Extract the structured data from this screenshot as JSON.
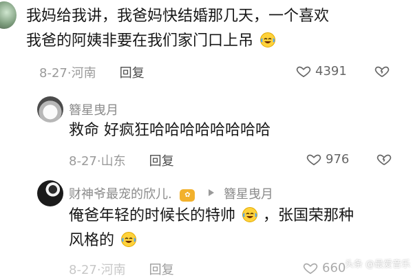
{
  "comments": [
    {
      "text_line1": "我妈给我讲，我爸妈快结婚那几天，一个喜欢",
      "text_line2": "我爸的阿姨非要在我们家门口上吊",
      "date_location": "8-27·河南",
      "reply_label": "回复",
      "likes": "4391"
    }
  ],
  "replies": [
    {
      "username": "簪星曳月",
      "text": "救命 好疯狂哈哈哈哈哈哈哈哈",
      "date_location": "8-27·山东",
      "reply_label": "回复",
      "likes": "976"
    },
    {
      "username": "财神爷最宠的欣儿.",
      "reply_to": "簪星曳月",
      "text_line1": "俺爸年轻的时候长的特帅",
      "text_line1b": "，张国荣那种",
      "text_line2": "风格的",
      "date_location": "8-27·河南",
      "reply_label": "回复",
      "likes": "660"
    }
  ],
  "watermark": "头条 @最爱音乐",
  "colors": {
    "text_primary": "#171717",
    "text_meta": "#9a9a9a",
    "text_username": "#8b8b8b",
    "accent_pill": "#f2b12c"
  },
  "icons": {
    "heart": "heart-icon",
    "broken_heart": "broken-heart-icon",
    "laughing_crying_emoji": "laughing-crying-emoji"
  }
}
